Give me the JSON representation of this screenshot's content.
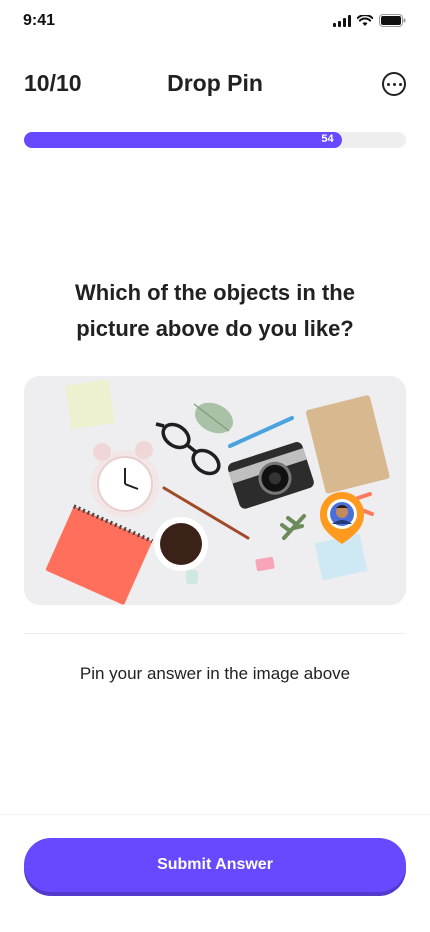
{
  "status_bar": {
    "time": "9:41"
  },
  "header": {
    "progress_count": "10/10",
    "title": "Drop Pin",
    "more_icon": "more-circle-icon"
  },
  "progress": {
    "value": 54,
    "max": 100,
    "label": "54",
    "fill_color": "#6949ff",
    "track_color": "#eeeeee"
  },
  "question": {
    "text": "Which of the objects in the picture above do you like?"
  },
  "image": {
    "description_icon": "desk-objects-photo",
    "pin_icon": "user-avatar-pin-icon"
  },
  "hint": {
    "text": "Pin your answer in the image above"
  },
  "footer": {
    "submit_label": "Submit Answer",
    "accent": "#6949ff"
  }
}
